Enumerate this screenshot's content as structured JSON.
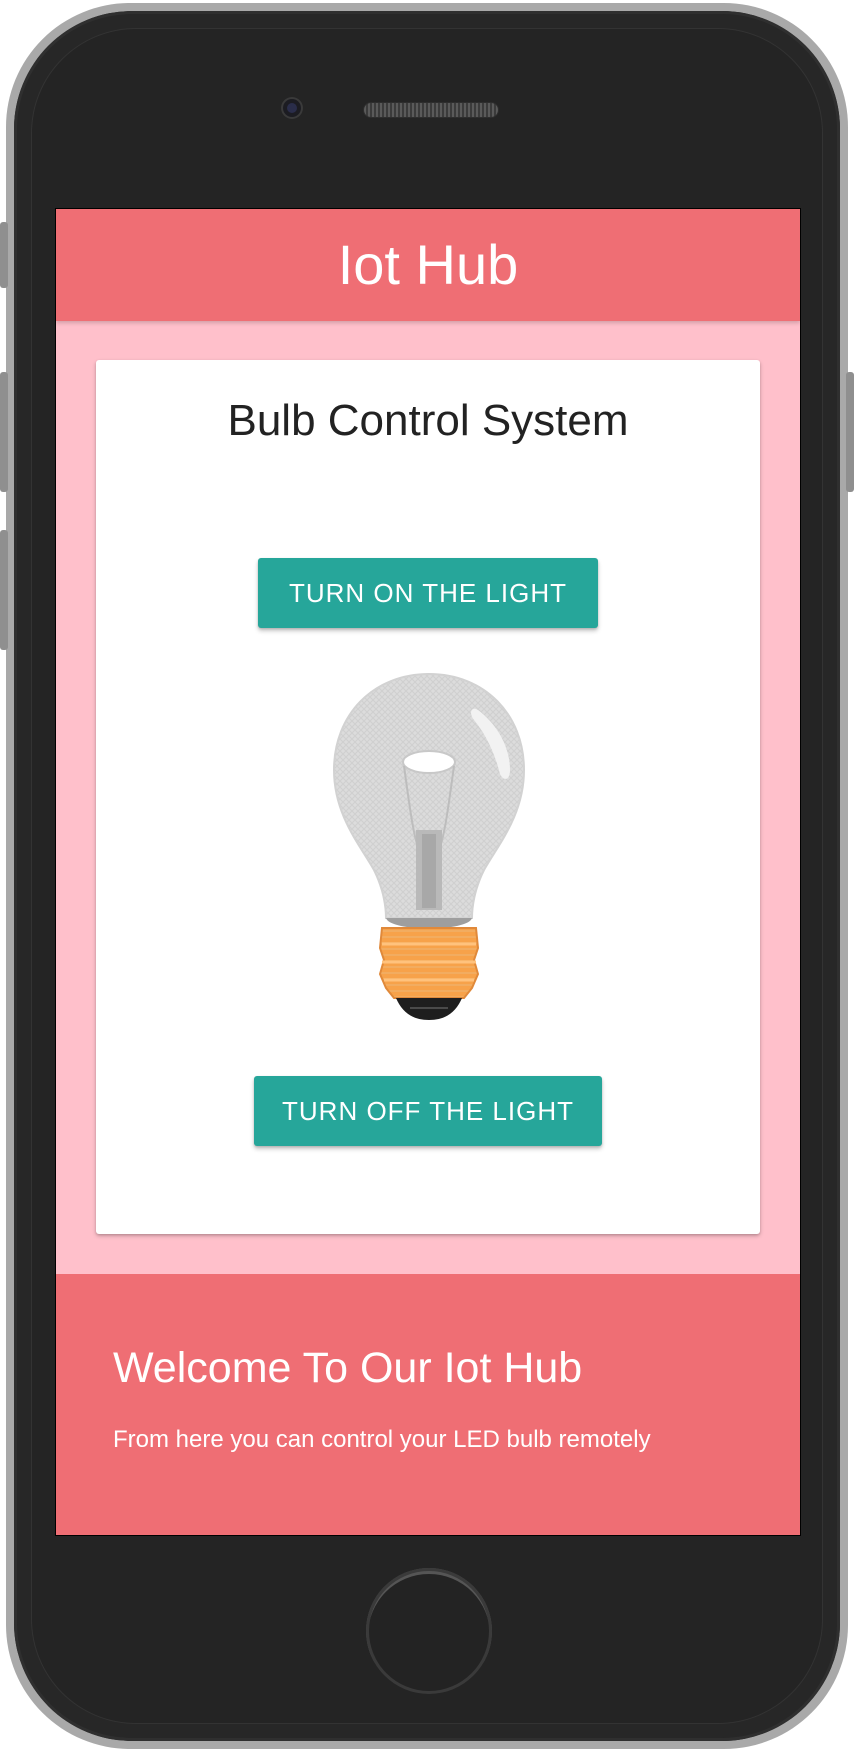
{
  "app": {
    "title": "Iot Hub"
  },
  "card": {
    "title": "Bulb Control System",
    "turn_on_label": "TURN ON THE LIGHT",
    "turn_off_label": "TURN OFF THE LIGHT",
    "bulb_icon": "lightbulb-icon",
    "bulb_state": "off"
  },
  "footer": {
    "title": "Welcome To Our Iot Hub",
    "text": "From here you can control your LED bulb remotely"
  },
  "colors": {
    "header": "#ef6e74",
    "background": "#ffc0cb",
    "button": "#26a69a",
    "card": "#ffffff"
  }
}
